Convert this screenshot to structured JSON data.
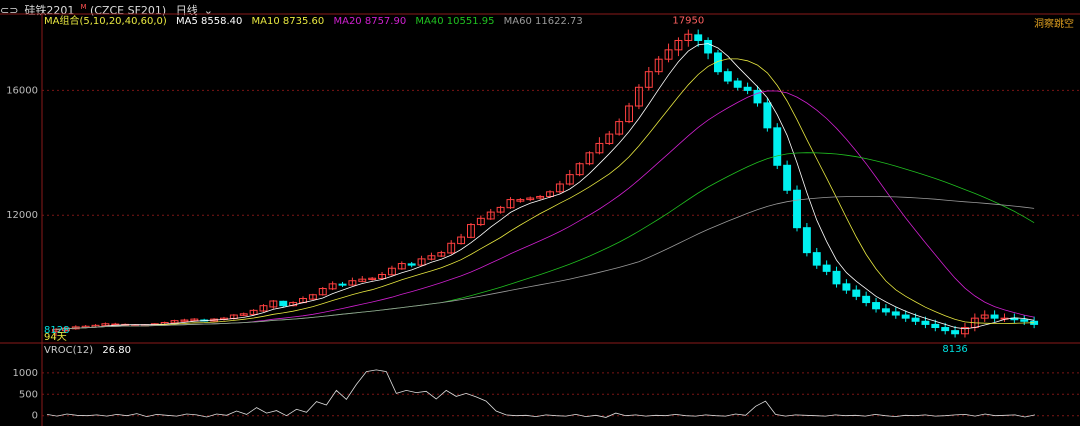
{
  "header": {
    "symbol": "硅铁2201",
    "symbol_sup": "M",
    "exchange": "(CZCE SF201)",
    "period": "日线",
    "period_arrow": "⌄"
  },
  "top_right_label": "洞察跳空",
  "ma_legend": {
    "title": "MA组合(5,10,20,40,60,0)",
    "items": [
      {
        "label": "MA5 8558.40",
        "color": "#ffffff"
      },
      {
        "label": "MA10 8735.60",
        "color": "#e8e840"
      },
      {
        "label": "MA20 8757.90",
        "color": "#d020d0"
      },
      {
        "label": "MA40 10551.95",
        "color": "#20c020"
      },
      {
        "label": "MA60 11622.73",
        "color": "#9a9a9a"
      }
    ]
  },
  "vroc_legend": {
    "title": "VROC(12)",
    "value": "26.80"
  },
  "colors": {
    "up": "#ff4040",
    "down": "#00f0f0",
    "grid": "#7a1515",
    "axis": "#8a1a1a",
    "ma5": "#ffffff",
    "ma10": "#e8e840",
    "ma20": "#d020d0",
    "ma40": "#20c020",
    "ma60": "#9a9a9a",
    "vroc": "#dddddd"
  },
  "chart_data": [
    {
      "type": "candlestick",
      "title": "硅铁2201 (CZCE SF201) 日线",
      "ylim": [
        8000,
        18000
      ],
      "yticks": [
        12000,
        16000
      ],
      "annotations": {
        "high": "17950",
        "low": "8136",
        "left_low": "8128",
        "left_label": "94天"
      },
      "candles": [
        [
          8280,
          8340,
          8120,
          8380
        ],
        [
          8300,
          8380,
          8260,
          8420
        ],
        [
          8360,
          8420,
          8330,
          8470
        ],
        [
          8400,
          8440,
          8370,
          8480
        ],
        [
          8420,
          8470,
          8400,
          8510
        ],
        [
          8460,
          8520,
          8430,
          8560
        ],
        [
          8500,
          8510,
          8460,
          8550
        ],
        [
          8480,
          8500,
          8450,
          8530
        ],
        [
          8470,
          8480,
          8440,
          8510
        ],
        [
          8470,
          8480,
          8440,
          8510
        ],
        [
          8480,
          8520,
          8460,
          8540
        ],
        [
          8500,
          8560,
          8480,
          8590
        ],
        [
          8550,
          8620,
          8530,
          8650
        ],
        [
          8600,
          8640,
          8580,
          8680
        ],
        [
          8620,
          8670,
          8590,
          8700
        ],
        [
          8640,
          8610,
          8590,
          8680
        ],
        [
          8610,
          8670,
          8580,
          8700
        ],
        [
          8660,
          8700,
          8620,
          8740
        ],
        [
          8690,
          8800,
          8650,
          8830
        ],
        [
          8790,
          8840,
          8760,
          8880
        ],
        [
          8820,
          8950,
          8800,
          8990
        ],
        [
          8930,
          9100,
          8900,
          9150
        ],
        [
          9060,
          9250,
          9000,
          9280
        ],
        [
          9240,
          9100,
          9050,
          9260
        ],
        [
          9100,
          9200,
          9080,
          9240
        ],
        [
          9200,
          9330,
          9180,
          9400
        ],
        [
          9310,
          9450,
          9280,
          9480
        ],
        [
          9450,
          9650,
          9420,
          9700
        ],
        [
          9640,
          9800,
          9600,
          9880
        ],
        [
          9790,
          9760,
          9700,
          9860
        ],
        [
          9760,
          9900,
          9740,
          10000
        ],
        [
          9880,
          9950,
          9850,
          10050
        ],
        [
          9940,
          9980,
          9900,
          10020
        ],
        [
          9970,
          10100,
          9930,
          10180
        ],
        [
          10090,
          10300,
          10060,
          10380
        ],
        [
          10280,
          10450,
          10250,
          10520
        ],
        [
          10440,
          10400,
          10330,
          10500
        ],
        [
          10400,
          10600,
          10370,
          10700
        ],
        [
          10590,
          10700,
          10550,
          10800
        ],
        [
          10690,
          10800,
          10660,
          10860
        ],
        [
          10790,
          11100,
          10750,
          11200
        ],
        [
          11090,
          11300,
          11060,
          11400
        ],
        [
          11290,
          11700,
          11260,
          11750
        ],
        [
          11700,
          11900,
          11650,
          11990
        ],
        [
          11880,
          12100,
          11850,
          12200
        ],
        [
          12100,
          12250,
          12050,
          12300
        ],
        [
          12240,
          12500,
          12200,
          12580
        ],
        [
          12450,
          12500,
          12400,
          12550
        ],
        [
          12500,
          12550,
          12450,
          12600
        ],
        [
          12550,
          12600,
          12500,
          12650
        ],
        [
          12600,
          12750,
          12550,
          12800
        ],
        [
          12750,
          13000,
          12700,
          13100
        ],
        [
          13000,
          13300,
          12950,
          13450
        ],
        [
          13300,
          13650,
          13250,
          13700
        ],
        [
          13650,
          14000,
          13600,
          14050
        ],
        [
          14000,
          14300,
          13950,
          14500
        ],
        [
          14300,
          14600,
          14250,
          14700
        ],
        [
          14600,
          15000,
          14550,
          15100
        ],
        [
          15000,
          15500,
          14950,
          15600
        ],
        [
          15500,
          16100,
          15400,
          16200
        ],
        [
          16100,
          16600,
          16000,
          16750
        ],
        [
          16600,
          17000,
          16500,
          17100
        ],
        [
          17000,
          17300,
          16900,
          17500
        ],
        [
          17300,
          17600,
          17100,
          17700
        ],
        [
          17600,
          17800,
          17400,
          17950
        ],
        [
          17780,
          17600,
          17400,
          17950
        ],
        [
          17600,
          17200,
          17000,
          17700
        ],
        [
          17200,
          16600,
          16500,
          17300
        ],
        [
          16600,
          16300,
          16200,
          16700
        ],
        [
          16300,
          16100,
          16000,
          16400
        ]
      ],
      "ma_note": "moving averages shown as lines"
    },
    {
      "type": "line",
      "title": "VROC(12)",
      "ylim": [
        -100,
        1300
      ],
      "yticks": [
        0,
        500,
        1000
      ],
      "series": [
        {
          "name": "VROC(12)",
          "values": [
            30,
            -10,
            40,
            10,
            0,
            20,
            -10,
            30,
            0,
            50,
            -20,
            30,
            10,
            -10,
            40,
            20,
            -30,
            40,
            10,
            110,
            30,
            190,
            60,
            120,
            0,
            150,
            80,
            330,
            250,
            590,
            380,
            730,
            1030,
            1070,
            1030,
            520,
            590,
            540,
            570,
            390,
            590,
            450,
            520,
            440,
            340,
            110,
            20,
            0,
            10,
            -20,
            20,
            0,
            -10,
            30,
            -20,
            10,
            -40,
            60,
            0,
            20,
            -10,
            10,
            0,
            30,
            0,
            -10,
            20,
            0,
            -10,
            40,
            10,
            220,
            340,
            30,
            -10,
            20,
            10,
            0,
            -10,
            20,
            0,
            10,
            -10,
            30,
            0,
            -20,
            10,
            0,
            20,
            -10,
            0,
            20,
            30,
            -10,
            40,
            0,
            10,
            20,
            -30,
            20
          ]
        }
      ]
    }
  ]
}
